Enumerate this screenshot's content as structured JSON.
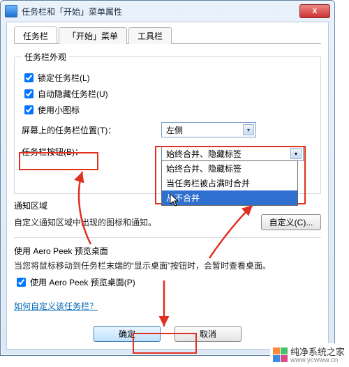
{
  "window": {
    "title": "任务栏和「开始」菜单属性",
    "close_label": "X"
  },
  "tabs": [
    {
      "label": "任务栏",
      "active": true
    },
    {
      "label": "「开始」菜单",
      "active": false
    },
    {
      "label": "工具栏",
      "active": false
    }
  ],
  "appearance": {
    "legend": "任务栏外观",
    "lock": {
      "label": "锁定任务栏(L)",
      "checked": true
    },
    "hide": {
      "label": "自动隐藏任务栏(U)",
      "checked": true
    },
    "small": {
      "label": "使用小图标",
      "checked": true
    },
    "position_label": "屏幕上的任务栏位置(T)：",
    "position_value": "左侧",
    "buttons_label": "任务栏按钮(B)：",
    "buttons_value": "始终合并、隐藏标签",
    "buttons_options": [
      "始终合并、隐藏标签",
      "当任务栏被占满时合并",
      "从不合并"
    ]
  },
  "notify": {
    "title": "通知区域",
    "desc": "自定义通知区域中出现的图标和通知。",
    "custom_btn": "自定义(C)..."
  },
  "aero": {
    "title": "使用 Aero Peek 预览桌面",
    "desc": "当您将鼠标移动到任务栏末端的“显示桌面”按钮时，会暂时查看桌面。",
    "checkbox": {
      "label": "使用 Aero Peek 预览桌面(P)",
      "checked": true
    }
  },
  "help_link": "如何自定义该任务栏？",
  "buttons": {
    "ok": "确定",
    "cancel": "取消"
  },
  "watermark": "www.ycwww.cn",
  "footer": {
    "name": "纯净系统之家",
    "url": "www.ycwww.cn"
  }
}
